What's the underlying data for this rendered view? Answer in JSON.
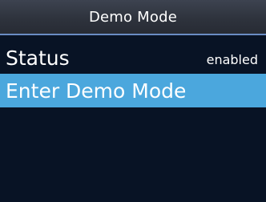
{
  "header": {
    "title": "Demo Mode"
  },
  "menu": {
    "items": [
      {
        "label": "Status",
        "value": "enabled",
        "selected": false
      },
      {
        "label": "Enter Demo Mode",
        "selected": true
      }
    ]
  },
  "colors": {
    "background": "#081325",
    "title_bar": "#2e333d",
    "divider": "#6a8cc4",
    "highlight": "#4ba7dd",
    "text": "#ffffff"
  }
}
